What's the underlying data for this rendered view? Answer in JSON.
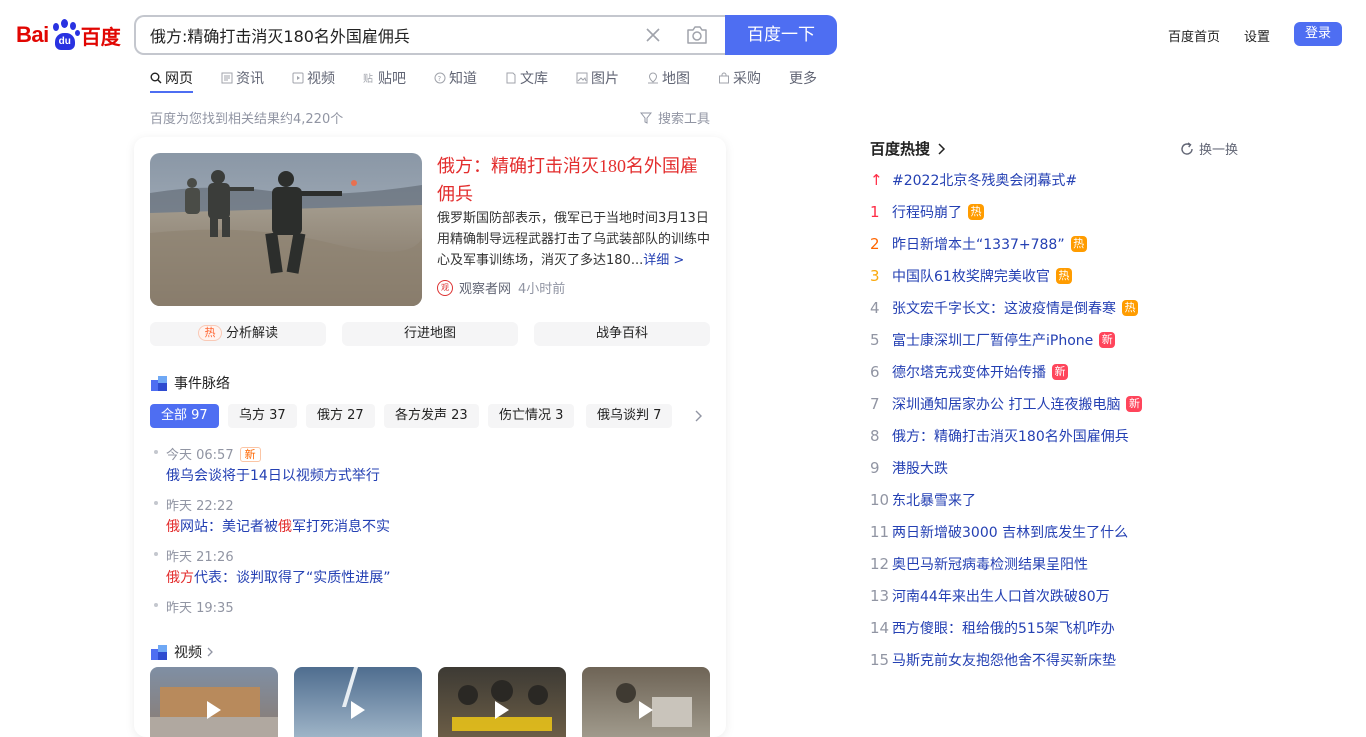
{
  "header": {
    "logo_left": "Bai",
    "logo_paw": "du",
    "logo_right": "百度",
    "search_value": "俄方:精确打击消灭180名外国雇佣兵",
    "search_button": "百度一下",
    "links": [
      "百度首页",
      "设置"
    ],
    "login": "登录"
  },
  "tabs": [
    {
      "label": "网页",
      "icon": "search-icon",
      "active": true
    },
    {
      "label": "资讯",
      "icon": "news-icon"
    },
    {
      "label": "视频",
      "icon": "video-icon"
    },
    {
      "label": "贴吧",
      "icon": "tieba-icon"
    },
    {
      "label": "知道",
      "icon": "question-icon"
    },
    {
      "label": "文库",
      "icon": "document-icon"
    },
    {
      "label": "图片",
      "icon": "image-icon"
    },
    {
      "label": "地图",
      "icon": "map-icon"
    },
    {
      "label": "采购",
      "icon": "shop-icon"
    },
    {
      "label": "更多"
    }
  ],
  "result_count": "百度为您找到相关结果约4,220个",
  "search_tools": "搜索工具",
  "card": {
    "title_prefix": "俄方",
    "title_colon": "：",
    "title_main": "精确打击消灭180名外国雇佣兵",
    "desc": "俄罗斯国防部表示，俄军已于当地时间3月13日用精确制导远程武器打击了乌武装部队的训练中心及军事训练场，消灭了多达180...",
    "more": "详细 >",
    "source_icon": "观",
    "source": "观察者网",
    "time": "4小时前",
    "pills": [
      {
        "label": "分析解读",
        "hot": "热"
      },
      {
        "label": "行进地图"
      },
      {
        "label": "战争百科"
      }
    ],
    "events_title": "事件脉络",
    "filters": [
      "全部 97",
      "乌方 37",
      "俄方 27",
      "各方发声 23",
      "伤亡情况 3",
      "俄乌谈判 7"
    ],
    "events": [
      {
        "time": "今天 06:57",
        "new": "新",
        "title": "俄乌会谈将于14日以视频方式举行"
      },
      {
        "time": "昨天 22:22",
        "hl1": "俄",
        "t1": "网站：美记者被",
        "hl2": "俄",
        "t2": "军打死消息不实"
      },
      {
        "time": "昨天 21:26",
        "hl1": "俄方",
        "t1": "代表：谈判取得了“实质性进展”"
      },
      {
        "time": "昨天 19:35"
      }
    ],
    "video_title": "视频"
  },
  "hot": {
    "title": "百度热搜",
    "refresh": "换一换",
    "items": [
      {
        "rank": "↑",
        "title": "#2022北京冬残奥会闭幕式#"
      },
      {
        "rank": "1",
        "title": "行程码崩了",
        "badge": "热"
      },
      {
        "rank": "2",
        "title": "昨日新增本土“1337+788”",
        "badge": "热"
      },
      {
        "rank": "3",
        "title": "中国队61枚奖牌完美收官",
        "badge": "热"
      },
      {
        "rank": "4",
        "title": "张文宏千字长文：这波疫情是倒春寒",
        "badge": "热"
      },
      {
        "rank": "5",
        "title": "富士康深圳工厂暂停生产iPhone",
        "badge": "新"
      },
      {
        "rank": "6",
        "title": "德尔塔克戎变体开始传播",
        "badge": "新"
      },
      {
        "rank": "7",
        "title": "深圳通知居家办公 打工人连夜搬电脑",
        "badge": "新"
      },
      {
        "rank": "8",
        "title": "俄方：精确打击消灭180名外国雇佣兵"
      },
      {
        "rank": "9",
        "title": "港股大跌"
      },
      {
        "rank": "10",
        "title": "东北暴雪来了"
      },
      {
        "rank": "11",
        "title": "两日新增破3000 吉林到底发生了什么"
      },
      {
        "rank": "12",
        "title": "奥巴马新冠病毒检测结果呈阳性"
      },
      {
        "rank": "13",
        "title": "河南44年来出生人口首次跌破80万"
      },
      {
        "rank": "14",
        "title": "西方傻眼：租给俄的515架飞机咋办"
      },
      {
        "rank": "15",
        "title": "马斯克前女友抱怨他舍不得买新床垫"
      }
    ]
  },
  "colors": {
    "brand_blue": "#4e6ef2",
    "link_blue": "#2440b3",
    "red": "#e32e2e",
    "logo_red": "#e10602"
  }
}
